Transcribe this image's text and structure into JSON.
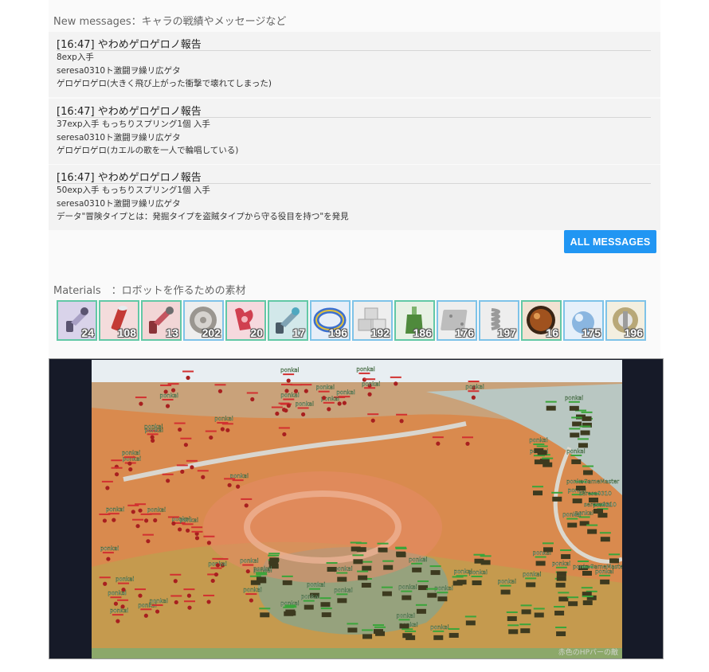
{
  "messages_section": {
    "title": "New messages：キャラの戦績やメッセージなど",
    "items": [
      {
        "header": "[16:47] やわめゲロゲロノ報告",
        "lines": [
          "8exp入手",
          "seresa0310ト激闘ヲ繰リ広ゲタ",
          "ゲロゲロゲロ(大きく飛び上がった衝撃で壊れてしまった)"
        ]
      },
      {
        "header": "[16:47] やわめゲロゲロノ報告",
        "lines": [
          "37exp入手 もっちりスプリング1個 入手",
          "seresa0310ト激闘ヲ繰リ広ゲタ",
          "ゲロゲロゲロ(カエルの歌を一人で輪唱している)"
        ]
      },
      {
        "header": "[16:47] やわめゲロゲロノ報告",
        "lines": [
          "50exp入手 もっちりスプリング1個 入手",
          "seresa0310ト激闘ヲ繰リ広ゲタ",
          "データ\"冒険タイプとは：発掘タイプを盗賊タイプから守る役目を持つ\"を発見"
        ]
      }
    ],
    "all_button_label": "ALL MESSAGES"
  },
  "materials_section": {
    "title": "Materials　：ロボットを作るための素材",
    "items": [
      {
        "icon": "robot-arm-purple-icon",
        "count": "24",
        "border": "green",
        "bg": "#d9d3ea",
        "color": "#5a5470"
      },
      {
        "icon": "red-cylinder-icon",
        "count": "108",
        "border": "green",
        "bg": "#f4dcdc",
        "color": "#c43a35"
      },
      {
        "icon": "robot-arm-red-icon",
        "count": "13",
        "border": "green",
        "bg": "#f2d6d6",
        "color": "#8a3338"
      },
      {
        "icon": "gear-wheel-icon",
        "count": "202",
        "border": "blue",
        "bg": "#eeeeee",
        "color": "#9a9690"
      },
      {
        "icon": "red-claw-icon",
        "count": "20",
        "border": "green",
        "bg": "#f6d9de",
        "color": "#d04050"
      },
      {
        "icon": "robot-arm-teal-icon",
        "count": "17",
        "border": "green",
        "bg": "#d2e8ea",
        "color": "#4a5a66"
      },
      {
        "icon": "colored-ring-icon",
        "count": "196",
        "border": "blue",
        "bg": "#e6eef8",
        "color": "#3b6fd0"
      },
      {
        "icon": "metal-cubes-icon",
        "count": "192",
        "border": "blue",
        "bg": "#eeeeee",
        "color": "#a6a6a6"
      },
      {
        "icon": "green-flask-icon",
        "count": "186",
        "border": "green",
        "bg": "#e7f1e4",
        "color": "#4f8a3c"
      },
      {
        "icon": "metal-plate-icon",
        "count": "176",
        "border": "blue",
        "bg": "#eeeeee",
        "color": "#bdbdbd"
      },
      {
        "icon": "metal-spring-icon",
        "count": "197",
        "border": "blue",
        "bg": "#eeeeee",
        "color": "#9a9a9a"
      },
      {
        "icon": "rusty-sphere-icon",
        "count": "16",
        "border": "green",
        "bg": "#f1e2d2",
        "color": "#a0521e"
      },
      {
        "icon": "blue-orb-icon",
        "count": "175",
        "border": "blue",
        "bg": "#e6f0fa",
        "color": "#8ab6e0"
      },
      {
        "icon": "silver-bolt-icon",
        "count": "196",
        "border": "blue",
        "bg": "#f3efe0",
        "color": "#b8a878"
      }
    ]
  },
  "map": {
    "unit_label": "ponkai",
    "player_labels": [
      "seresa0310",
      "seresa0310",
      "ponkaGameMaster",
      "ponkaGameMaster"
    ],
    "caption": "赤色のHPバーの敵"
  }
}
